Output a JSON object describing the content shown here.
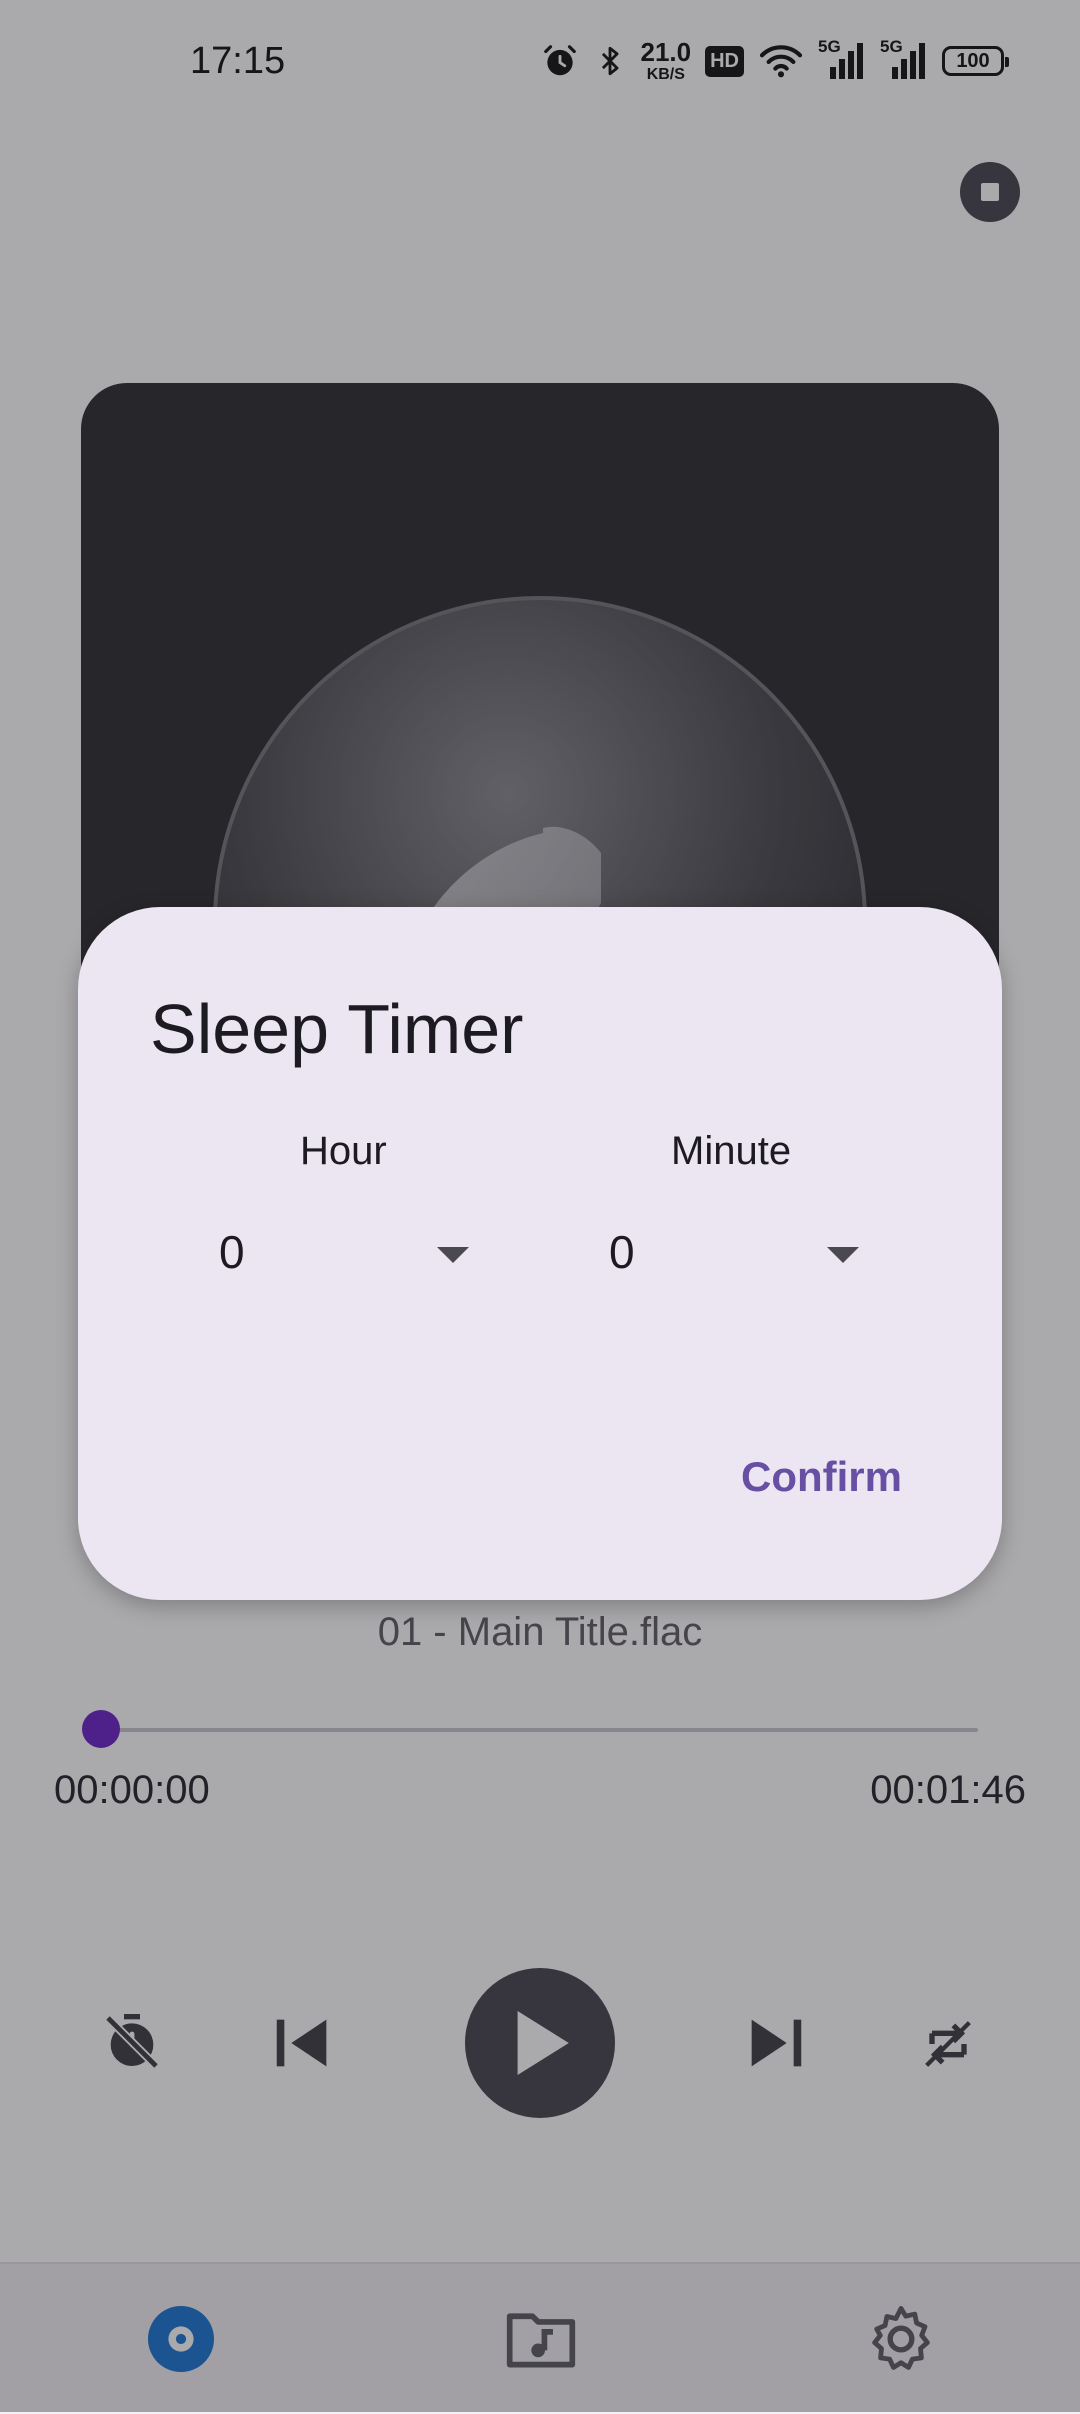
{
  "status_bar": {
    "time": "17:15",
    "net_speed_value": "21.0",
    "net_speed_unit": "KB/S",
    "hd_badge": "HD",
    "signal_1_label": "5G",
    "signal_2_label": "5G",
    "battery": "100",
    "icons": [
      "alarm-icon",
      "bluetooth-icon",
      "wifi-icon",
      "cell-signal-icon",
      "battery-icon"
    ]
  },
  "player": {
    "track_title": "01 - Main Title.flac",
    "time_current": "00:00:00",
    "time_total": "00:01:46",
    "progress": 0,
    "controls": [
      "sleep-timer-icon",
      "previous-icon",
      "play-icon",
      "next-icon",
      "repeat-icon"
    ]
  },
  "bottom_nav": {
    "items": [
      "now-playing-icon",
      "music-folder-icon",
      "settings-icon"
    ],
    "active_index": 0
  },
  "dialog": {
    "title": "Sleep Timer",
    "hour_label": "Hour",
    "hour_value": "0",
    "minute_label": "Minute",
    "minute_value": "0",
    "confirm_label": "Confirm"
  },
  "colors": {
    "accent": "#6750a4",
    "progress_thumb": "#6a23c8",
    "nav_active": "#1976d2",
    "dialog_bg": "#ece6f3",
    "control_dark": "#46454c"
  }
}
